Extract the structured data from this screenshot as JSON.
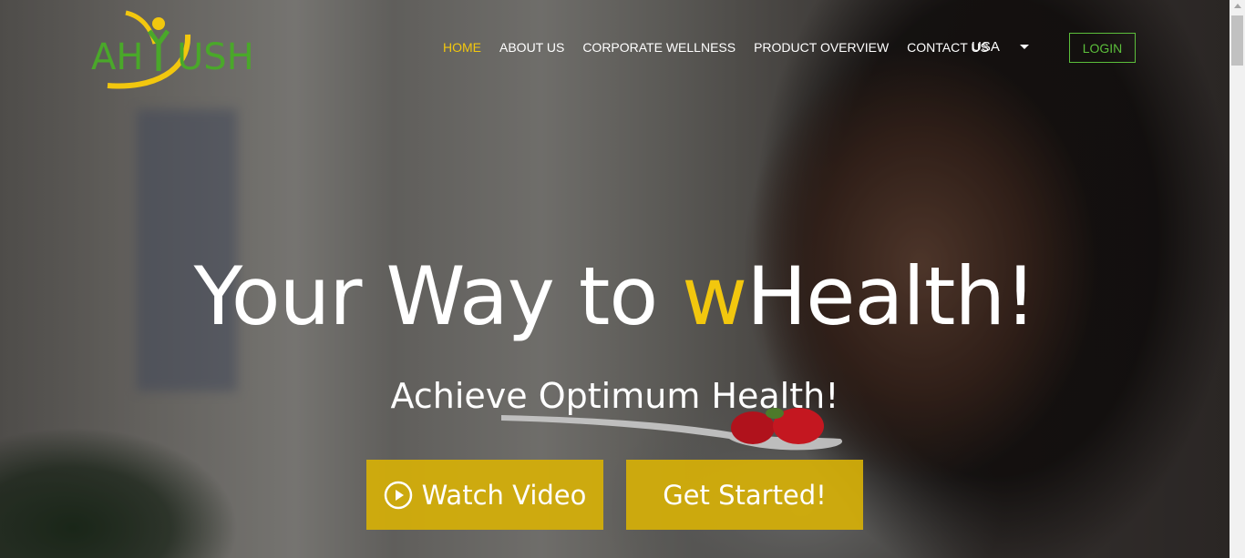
{
  "brand": {
    "logo_text": "AHYUSH",
    "colors": {
      "green": "#4aa82a",
      "yellow": "#f2c70e"
    }
  },
  "nav": {
    "items": [
      {
        "label": "HOME",
        "active": true
      },
      {
        "label": "ABOUT US",
        "active": false
      },
      {
        "label": "CORPORATE WELLNESS",
        "active": false
      },
      {
        "label": "PRODUCT OVERVIEW",
        "active": false
      },
      {
        "label": "CONTACT US",
        "active": false
      }
    ],
    "country": "USA",
    "login_label": "LOGIN"
  },
  "hero": {
    "headline_before": "Your Way to ",
    "headline_accent": "w",
    "headline_after": "Health!",
    "subheadline": "Achieve Optimum Health!",
    "watch_video_label": "Watch Video",
    "get_started_label": "Get Started!",
    "accent_color": "#f2c70e",
    "button_color": "#d6b008"
  },
  "icons": {
    "play": "play-circle-icon",
    "caret": "chevron-down-icon"
  }
}
